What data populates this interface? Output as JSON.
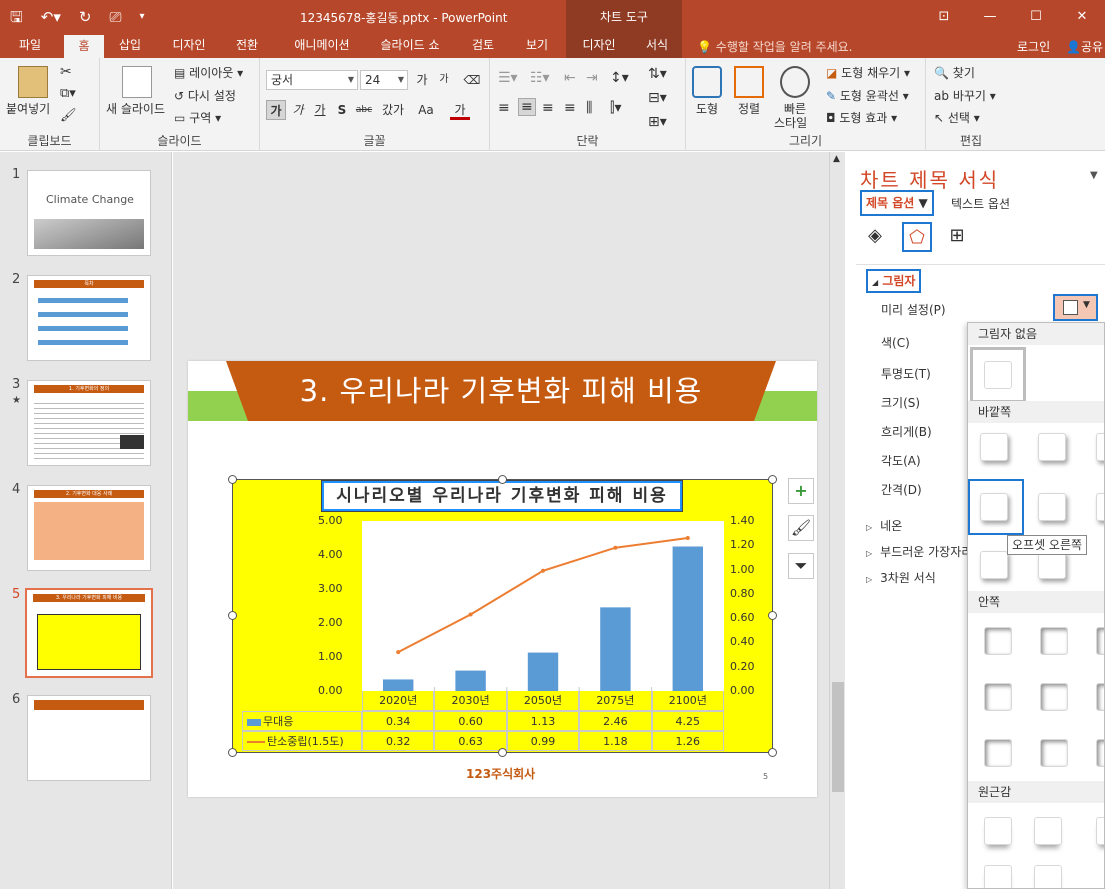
{
  "titlebar": {
    "doc_title": "12345678-홍길동.pptx - PowerPoint",
    "context_header": "차트 도구"
  },
  "tabs": {
    "file": "파일",
    "home": "홈",
    "insert": "삽입",
    "design": "디자인",
    "transitions": "전환",
    "animations": "애니메이션",
    "slideshow": "슬라이드 쇼",
    "review": "검토",
    "view": "보기",
    "chart_design": "디자인",
    "chart_format": "서식",
    "tell_me": "수행할 작업을 알려 주세요.",
    "login": "로그인",
    "share": "공유"
  },
  "ribbon": {
    "clipboard": {
      "paste": "붙여넣기",
      "label": "클립보드"
    },
    "slides": {
      "new_slide": "새 슬라이드",
      "layout": "레이아웃",
      "reset": "다시 설정",
      "section": "구역",
      "label": "슬라이드"
    },
    "font": {
      "font_name": "궁서",
      "font_size": "24",
      "grow": "가",
      "shrink": "가",
      "bold": "가",
      "italic": "가",
      "underline": "가",
      "shadow": "S",
      "strike": "abc",
      "spacing": "갔가",
      "case": "Aa",
      "color": "가",
      "label": "글꼴"
    },
    "paragraph": {
      "label": "단락"
    },
    "drawing": {
      "shapes": "도형",
      "arrange": "정렬",
      "quick_styles_1": "빠른",
      "quick_styles_2": "스타일",
      "fill": "도형 채우기",
      "outline": "도형 윤곽선",
      "effects": "도형 효과",
      "label": "그리기"
    },
    "editing": {
      "find": "찾기",
      "replace": "바꾸기",
      "select": "선택",
      "label": "편집"
    }
  },
  "thumbnails": [
    {
      "num": "1",
      "title": "Climate Change"
    },
    {
      "num": "2",
      "title": "목차"
    },
    {
      "num": "3",
      "title": "1. 기후변화의 정의"
    },
    {
      "num": "4",
      "title": "2. 기후변화 대응 사례"
    },
    {
      "num": "5",
      "title": "3. 우리나라 기후변화 피해 비용"
    },
    {
      "num": "6",
      "title": ""
    }
  ],
  "slide": {
    "title": "3. 우리나라 기후변화 피해 비용",
    "page_number": "5",
    "footer_logo": "123주식회사"
  },
  "chart_data": {
    "type": "bar",
    "title": "시나리오별 우리나라 기후변화 피해 비용",
    "categories": [
      "2020년",
      "2030년",
      "2050년",
      "2075년",
      "2100년"
    ],
    "series": [
      {
        "name": "무대응",
        "type": "bar",
        "axis": "left",
        "color": "#5b9bd5",
        "values": [
          0.34,
          0.6,
          1.13,
          2.46,
          4.25
        ]
      },
      {
        "name": "탄소중립(1.5도)",
        "type": "line",
        "axis": "right",
        "color": "#ed7d31",
        "values": [
          0.32,
          0.63,
          0.99,
          1.18,
          1.26
        ]
      }
    ],
    "y_left_ticks": [
      "5.00",
      "4.00",
      "3.00",
      "2.00",
      "1.00",
      "0.00"
    ],
    "y_right_ticks": [
      "1.40",
      "1.20",
      "1.00",
      "0.80",
      "0.60",
      "0.40",
      "0.20",
      "0.00"
    ],
    "ylim_left": [
      0,
      5
    ],
    "ylim_right": [
      0,
      1.4
    ],
    "table_values": {
      "무대응": [
        "0.34",
        "0.60",
        "1.13",
        "2.46",
        "4.25"
      ],
      "탄소중립(1.5도)": [
        "0.32",
        "0.63",
        "0.99",
        "1.18",
        "1.26"
      ]
    }
  },
  "pane": {
    "title": "차트 제목 서식",
    "title_options": "제목 옵션",
    "text_options": "텍스트 옵션",
    "shadow_section": "그림자",
    "presets": "미리 설정(P)",
    "color": "색(C)",
    "transparency": "투명도(T)",
    "size": "크기(S)",
    "blur": "흐리게(B)",
    "angle": "각도(A)",
    "distance": "간격(D)",
    "glow": "네온",
    "soft_edges": "부드러운 가장자리",
    "format_3d": "3차원 서식"
  },
  "gallery": {
    "no_shadow": "그림자 없음",
    "outer": "바깥쪽",
    "inner": "안쪽",
    "perspective": "원근감",
    "tooltip": "오프셋 오른쪽"
  }
}
